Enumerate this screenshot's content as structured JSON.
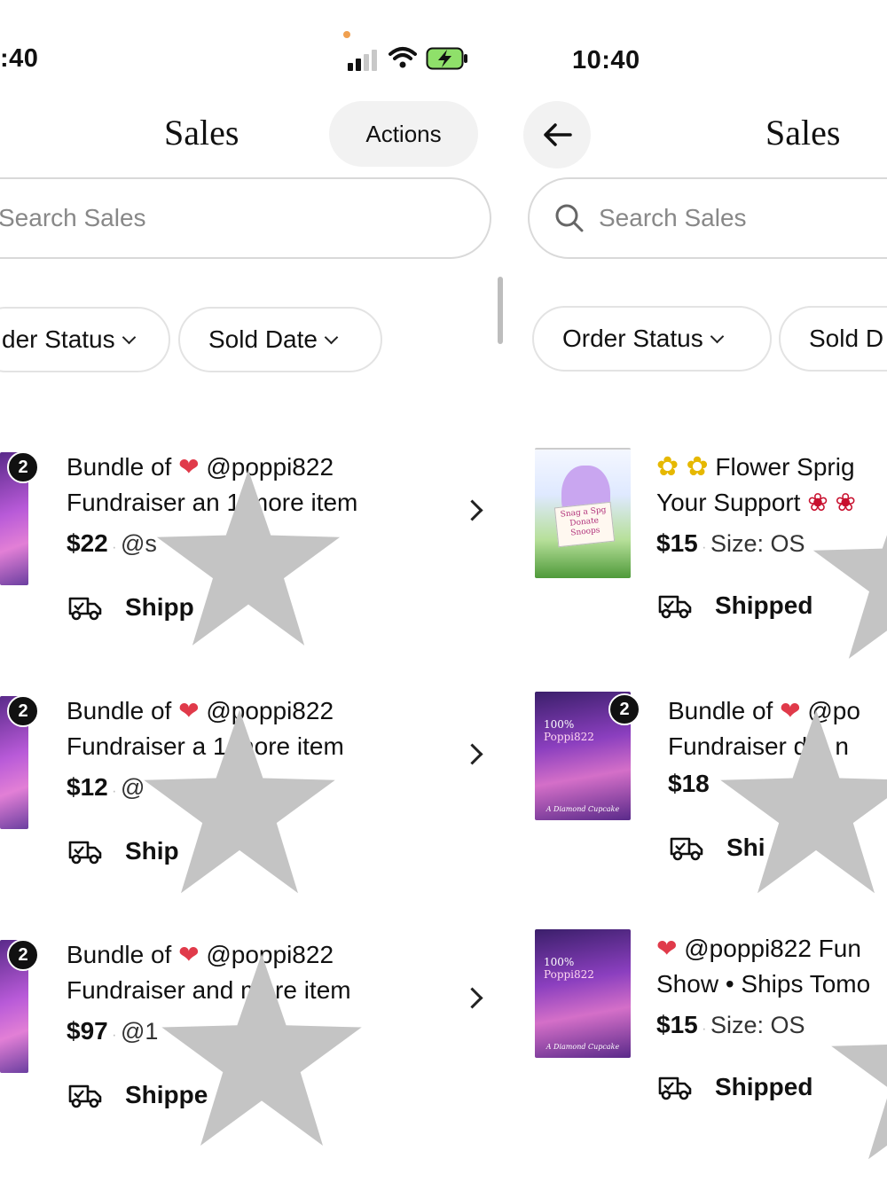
{
  "left": {
    "status_time": ":40",
    "title": "Sales",
    "actions_label": "Actions",
    "search_placeholder": "Search Sales",
    "filters": [
      "der Status",
      "Sold Date"
    ],
    "rows": [
      {
        "badge": "2",
        "line1a": "Bundle of",
        "line1b": "@poppi822",
        "line2": "Fundraiser an",
        "line2b": "1 more item",
        "price": "$22",
        "meta": "@s",
        "status": "Shipp"
      },
      {
        "badge": "2",
        "line1a": "Bundle of",
        "line1b": "@poppi822",
        "line2": "Fundraiser a",
        "line2b": "1 more item",
        "price": "$12",
        "meta": "@",
        "status": "Ship"
      },
      {
        "badge": "2",
        "line1a": "Bundle of",
        "line1b": "@poppi822",
        "line2": "Fundraiser and",
        "line2b": "more item",
        "price": "$97",
        "meta": "@1",
        "status": "Shippe"
      }
    ]
  },
  "right": {
    "status_time": "10:40",
    "title": "Sales",
    "search_placeholder": "Search Sales",
    "filters": [
      "Order Status",
      "Sold D"
    ],
    "rows": [
      {
        "line1": "Flower Sprig",
        "line2": "Your Support",
        "price": "$15",
        "meta": "Size: OS",
        "status": "Shipped",
        "thumb_text": [
          "Snag a Spg",
          "Donate",
          "Snoops"
        ]
      },
      {
        "badge": "2",
        "line1a": "Bundle of",
        "line1b": "@po",
        "line2": "Fundraiser",
        "line2b": "d 1 n",
        "price": "$18",
        "meta": "",
        "status": "Shi",
        "thumb_text": [
          "100%",
          "Poppi822",
          "A Diamond Cupcake"
        ]
      },
      {
        "line1": "@poppi822 Fun",
        "line2": "Show • Ships Tomo",
        "price": "$15",
        "meta": "Size: OS",
        "status": "Shipped",
        "thumb_text": [
          "100%",
          "Poppi822",
          "A Diamond Cupcake"
        ]
      }
    ]
  }
}
